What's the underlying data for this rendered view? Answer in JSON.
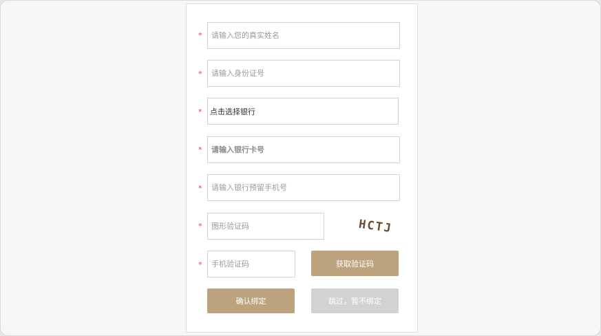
{
  "form": {
    "required_mark": "*",
    "name_placeholder": "请输入您的真实姓名",
    "id_placeholder": "请输入身份证号",
    "bank_select_label": "点击选择银行",
    "card_placeholder": "请输入银行卡号",
    "phone_placeholder": "请输入银行预留手机号",
    "image_code_placeholder": "图形验证码",
    "captcha_text": "HCTJ",
    "sms_code_placeholder": "手机验证码",
    "get_code_button": "获取验证码",
    "confirm_button": "确认绑定",
    "skip_button": "跳过，暂不绑定"
  },
  "colors": {
    "accent": "#bca27d",
    "disabled": "#d2d2d2",
    "required": "#e0463e",
    "captcha": "#6b4a2e"
  }
}
